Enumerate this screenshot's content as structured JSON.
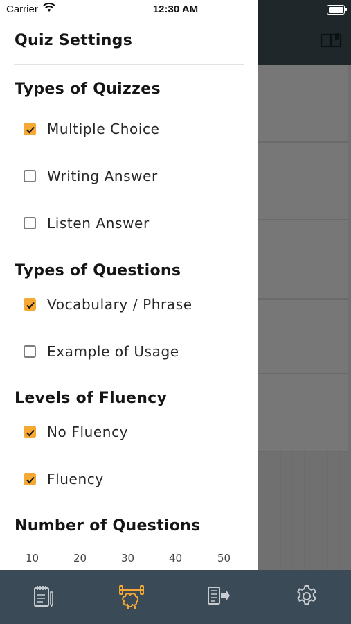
{
  "status_bar": {
    "carrier": "Carrier",
    "time": "12:30 AM"
  },
  "drawer": {
    "title": "Quiz Settings",
    "sections": [
      {
        "title": "Types of Quizzes",
        "options": [
          {
            "label": "Multiple Choice",
            "checked": true
          },
          {
            "label": "Writing Answer",
            "checked": false
          },
          {
            "label": "Listen Answer",
            "checked": false
          }
        ]
      },
      {
        "title": "Types of Questions",
        "options": [
          {
            "label": "Vocabulary / Phrase",
            "checked": true
          },
          {
            "label": "Example of Usage",
            "checked": false
          }
        ]
      },
      {
        "title": "Levels of Fluency",
        "options": [
          {
            "label": "No Fluency",
            "checked": true
          },
          {
            "label": "Fluency",
            "checked": true
          }
        ]
      },
      {
        "title": "Number of Questions",
        "slider_ticks": [
          "10",
          "20",
          "30",
          "40",
          "50"
        ]
      }
    ]
  },
  "tab_bar": {
    "tabs": [
      {
        "icon": "notebook-icon",
        "active": false
      },
      {
        "icon": "brain-workout-icon",
        "active": true
      },
      {
        "icon": "flashcard-icon",
        "active": false
      },
      {
        "icon": "gear-icon",
        "active": false
      }
    ]
  },
  "colors": {
    "accent": "#f5a834",
    "tab_bar_bg": "#3a4a56",
    "tab_icon": "#c8ccd0",
    "header_bg": "#1f272b"
  }
}
